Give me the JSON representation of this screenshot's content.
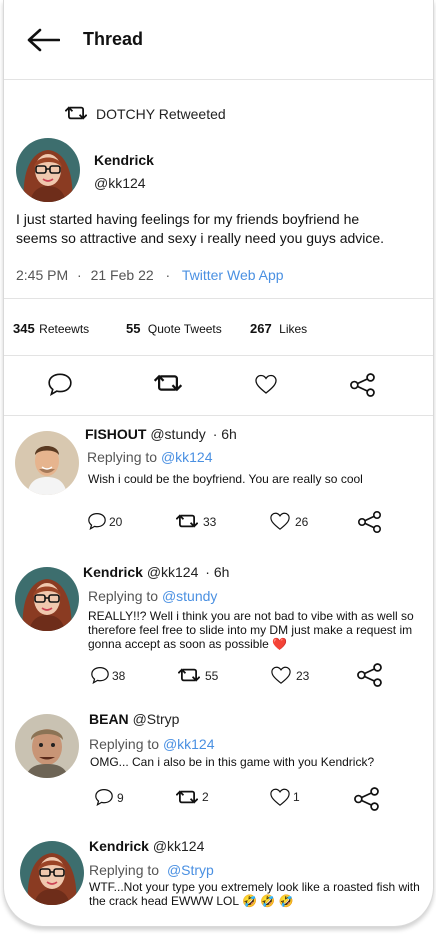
{
  "header": {
    "title": "Thread"
  },
  "retweet_note": "DOTCHY Retweeted",
  "main_tweet": {
    "name": "Kendrick",
    "handle": "@kk124",
    "text_line1": "I just started having feelings for my friends boyfriend he",
    "text_line2": "seems so attractive and sexy i really need you guys advice.",
    "time": "2:45 PM",
    "dot": "·",
    "date": "21 Feb 22",
    "source": "Twitter Web App"
  },
  "stats": {
    "retweets_count": "345",
    "retweets_label": "Reteewts",
    "quotes_count": "55",
    "quotes_label": "Quote Tweets",
    "likes_count": "267",
    "likes_label": "Likes"
  },
  "replies": [
    {
      "name": "FISHOUT",
      "handle": "@stundy",
      "time": "· 6h",
      "replying_prefix": "Replying to",
      "replying_to": "@kk124",
      "text_line1": "Wish i could be the boyfriend. You are really so cool",
      "comments": "20",
      "retweets": "33",
      "likes": "26"
    },
    {
      "name": "Kendrick",
      "handle": "@kk124",
      "time": "· 6h",
      "replying_prefix": "Replying to",
      "replying_to": "@stundy",
      "text_line1": "REALLY!!? Well i think you are not bad to vibe with as well so",
      "text_line2": "therefore feel free to slide into my DM just make a request im",
      "text_line3": "gonna accept as soon as possible",
      "emoji": "❤️",
      "comments": "38",
      "retweets": "55",
      "likes": "23"
    },
    {
      "name": "BEAN",
      "handle": "@Stryp",
      "replying_prefix": "Replying to",
      "replying_to": "@kk124",
      "text_line1": "OMG... Can i also be in this game with you Kendrick?",
      "comments": "9",
      "retweets": "2",
      "likes": "1"
    },
    {
      "name": "Kendrick",
      "handle": "@kk124",
      "replying_prefix": "Replying to",
      "replying_to": "@Stryp",
      "text_line1": "WTF...Not your type you extremely look like a roasted fish with",
      "text_line2": "the crack head EWWW LOL",
      "emoji": "🤣 🤣 🤣"
    }
  ],
  "colors": {
    "link": "#4a90e2",
    "heart": "#e02424",
    "divider": "#e3e3e3"
  },
  "icons": [
    "back-arrow-icon",
    "retweet-icon",
    "comment-icon",
    "heart-icon",
    "share-icon"
  ]
}
